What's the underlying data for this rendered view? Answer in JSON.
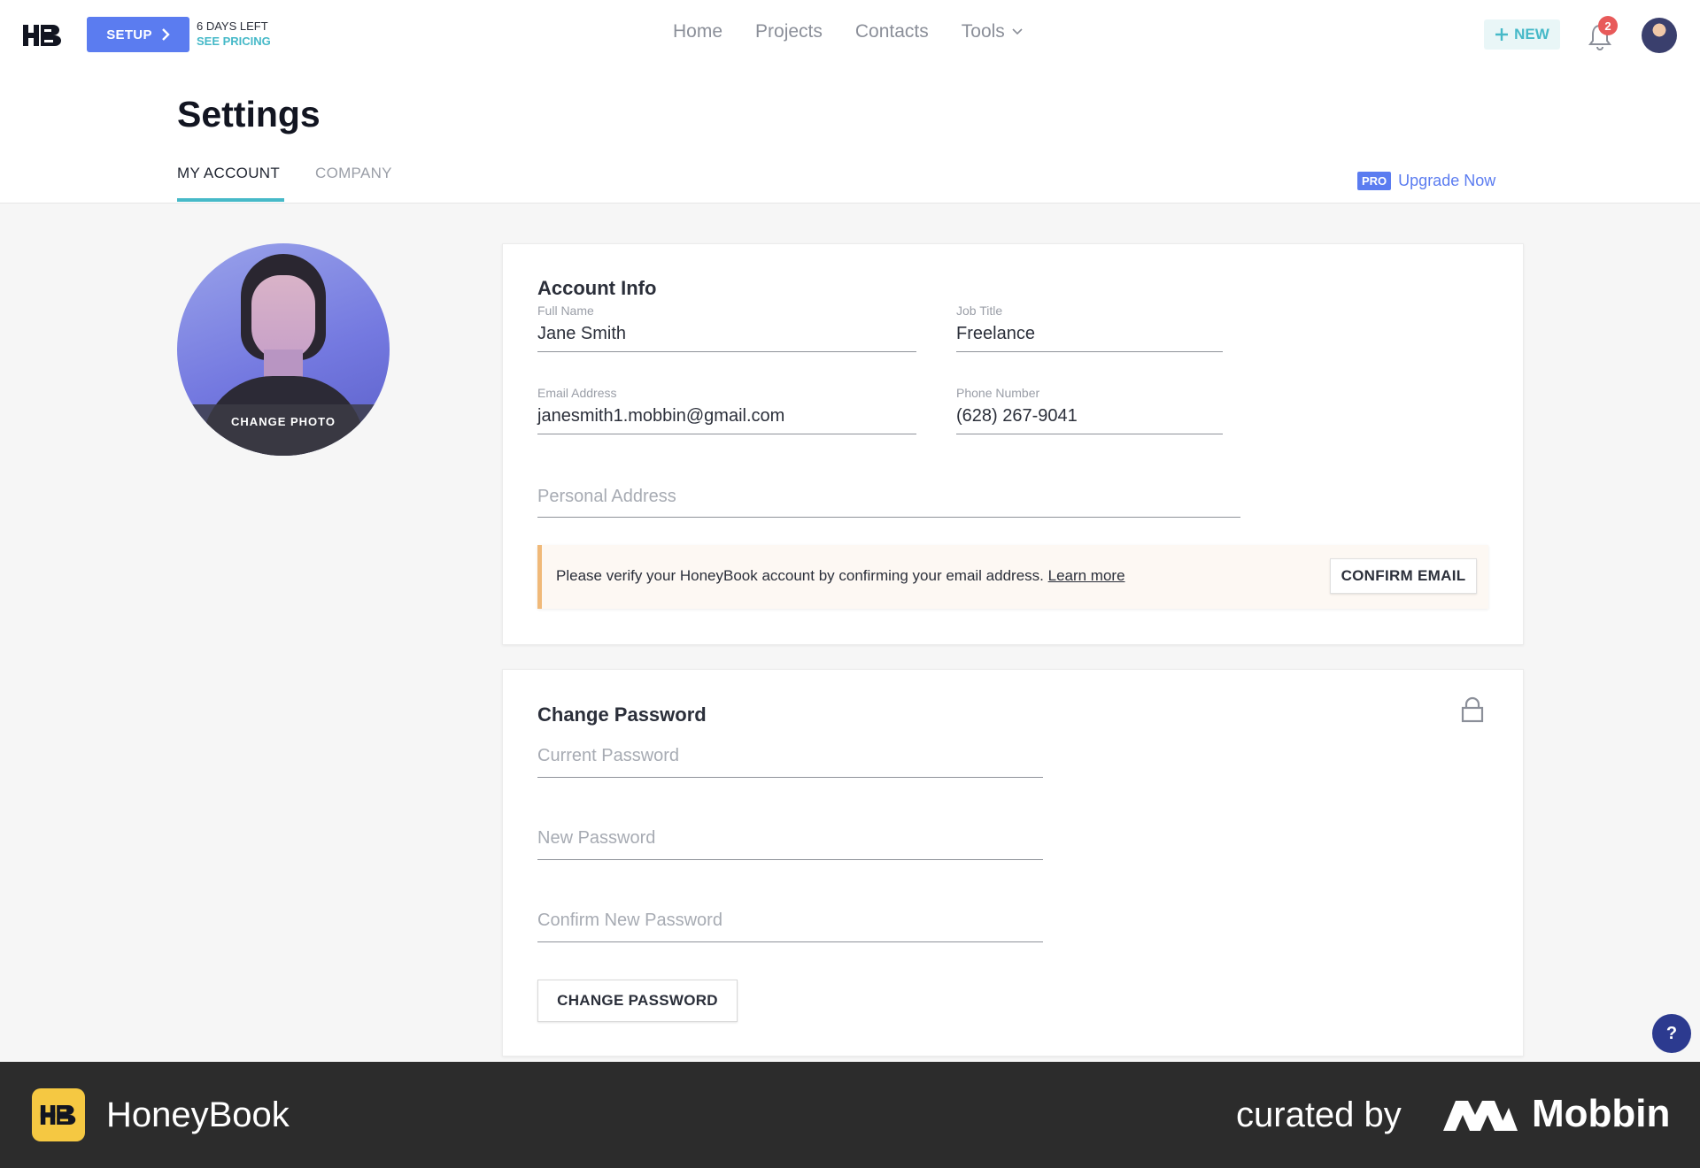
{
  "topbar": {
    "setup_label": "SETUP",
    "trial_days": "6 DAYS LEFT",
    "trial_pricing": "SEE PRICING",
    "nav": [
      "Home",
      "Projects",
      "Contacts",
      "Tools"
    ],
    "new_label": "NEW",
    "notification_count": "2"
  },
  "header": {
    "title": "Settings",
    "tabs": [
      "MY ACCOUNT",
      "COMPANY"
    ],
    "active_tab": "MY ACCOUNT",
    "pro_badge": "PRO",
    "upgrade_label": "Upgrade Now"
  },
  "profile": {
    "change_photo_label": "CHANGE PHOTO"
  },
  "account_info": {
    "title": "Account Info",
    "full_name_label": "Full Name",
    "full_name": "Jane Smith",
    "job_title_label": "Job Title",
    "job_title": "Freelance",
    "email_label": "Email Address",
    "email": "janesmith1.mobbin@gmail.com",
    "phone_label": "Phone Number",
    "phone": "(628) 267-9041",
    "address_placeholder": "Personal Address",
    "verify_text": "Please verify your HoneyBook account by confirming your email address.",
    "verify_link": "Learn more",
    "confirm_label": "CONFIRM EMAIL"
  },
  "change_password": {
    "title": "Change Password",
    "current_placeholder": "Current Password",
    "new_placeholder": "New Password",
    "confirm_placeholder": "Confirm New Password",
    "button_label": "CHANGE PASSWORD"
  },
  "help_label": "?",
  "footer": {
    "brand": "HoneyBook",
    "curated_by": "curated by",
    "curator": "Mobbin"
  },
  "colors": {
    "accent_blue": "#5b7cf0",
    "accent_teal": "#46b9c8",
    "warning_border": "#f0b979",
    "badge_red": "#e85a5a"
  }
}
